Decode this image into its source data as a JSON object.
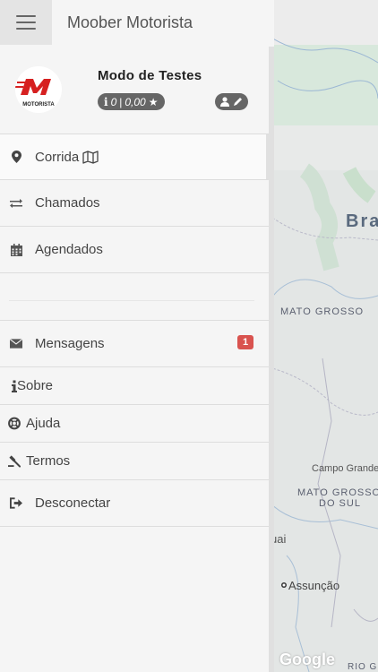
{
  "header": {
    "app_title": "Moober Motorista"
  },
  "profile": {
    "name": "Modo de Testes",
    "rating_count": "0",
    "rating_separator": "|",
    "rating_value": "0,00",
    "logo_text": "MOTORISTA"
  },
  "menu": {
    "corrida": "Corrida",
    "chamados": "Chamados",
    "agendados": "Agendados",
    "mensagens": "Mensagens",
    "mensagens_badge": "1",
    "sobre": "Sobre",
    "ajuda": "Ajuda",
    "termos": "Termos",
    "desconectar": "Desconectar"
  },
  "map": {
    "labels": {
      "brasil": "Bra",
      "mato_grosso": "MATO GROSSO",
      "campo_grande": "Campo Grande",
      "ms_line1": "MATO GROSSO",
      "ms_line2": "DO SUL",
      "paraguai": "uai",
      "assuncao": "Assunção",
      "google": "Google",
      "rio_grande": "RIO G"
    }
  },
  "colors": {
    "badge_red": "#d9534f",
    "badge_gray": "#666666",
    "logo_red": "#d62020"
  }
}
